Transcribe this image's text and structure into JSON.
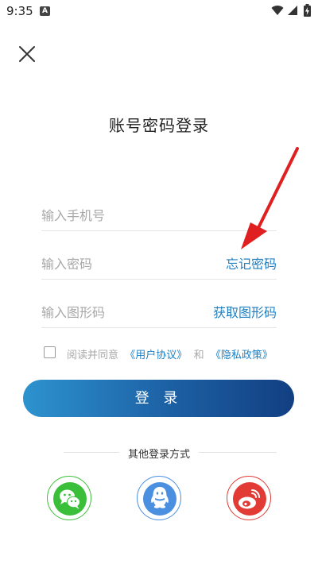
{
  "status_bar": {
    "time": "9:35",
    "notification": "A"
  },
  "header": {
    "title": "账号密码登录"
  },
  "form": {
    "phone_placeholder": "输入手机号",
    "password_placeholder": "输入密码",
    "forgot_password": "忘记密码",
    "captcha_placeholder": "输入图形码",
    "get_captcha": "获取图形码"
  },
  "agreement": {
    "prefix": "阅读并同意",
    "user_agreement": "《用户协议》",
    "and": "和",
    "privacy_policy": "《隐私政策》"
  },
  "login_button": "登 录",
  "other_login": {
    "label": "其他登录方式",
    "providers": [
      "wechat",
      "qq",
      "weibo"
    ]
  },
  "colors": {
    "accent_link": "#1e7fc3",
    "button_gradient_start": "#2d93cf",
    "button_gradient_end": "#123f82",
    "annotation_arrow": "#e02020",
    "wechat": "#3bbf3b",
    "qq": "#4b8fe0",
    "weibo": "#e23a34"
  }
}
